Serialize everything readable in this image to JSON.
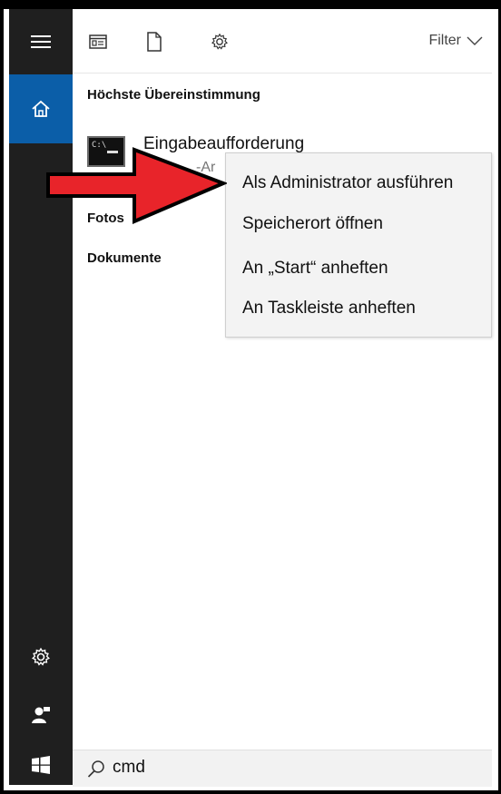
{
  "toolbar": {
    "icons": [
      "apps-icon",
      "document-icon",
      "gear-icon"
    ],
    "filter_label": "Filter"
  },
  "results": {
    "best_match_heading": "Höchste Übereinstimmung",
    "best_match": {
      "title": "Eingabeaufforderung",
      "subtitle_partial": "-Ar",
      "icon": "command-prompt-icon"
    },
    "categories": [
      "Fotos",
      "Dokumente"
    ]
  },
  "context_menu": {
    "items": [
      "Als Administrator ausführen",
      "Speicherort öffnen",
      "An „Start“ anheften",
      "An Taskleiste anheften"
    ]
  },
  "annotation": {
    "arrow_color": "#e8242a"
  },
  "rail": {
    "items": [
      "menu-icon",
      "home-icon",
      "gear-icon",
      "user-icon",
      "windows-start-icon"
    ],
    "accent": "#0b5ea8"
  },
  "search": {
    "value": "cmd"
  }
}
